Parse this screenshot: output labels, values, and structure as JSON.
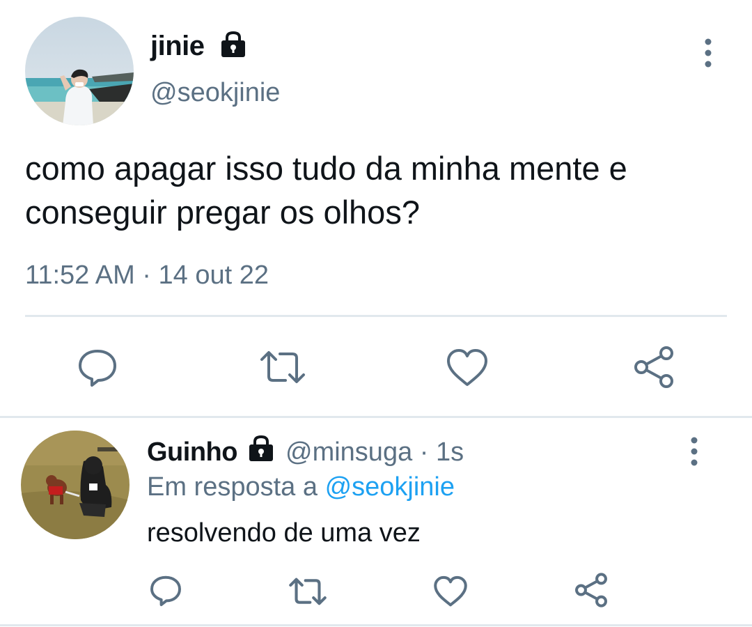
{
  "main_tweet": {
    "author": {
      "display_name": "jinie",
      "handle": "@seokjinie",
      "protected_icon": "lock-icon"
    },
    "text": "como apagar isso tudo da minha mente e conseguir pregar os olhos?",
    "timestamp": "11:52 AM · 14 out 22",
    "actions": [
      "reply-icon",
      "retweet-icon",
      "like-icon",
      "share-icon"
    ]
  },
  "reply_tweet": {
    "author": {
      "display_name": "Guinho",
      "handle_time": "@minsuga · 1s",
      "protected_icon": "lock-icon"
    },
    "in_reply_prefix": "Em resposta a",
    "in_reply_mention": "@seokjinie",
    "text": "resolvendo de uma vez",
    "actions": [
      "reply-icon",
      "retweet-icon",
      "like-icon",
      "share-icon"
    ]
  },
  "colors": {
    "text_primary": "#0f1419",
    "text_secondary": "#5b7083",
    "link": "#1da1f2",
    "divider": "#e1e8ed"
  }
}
